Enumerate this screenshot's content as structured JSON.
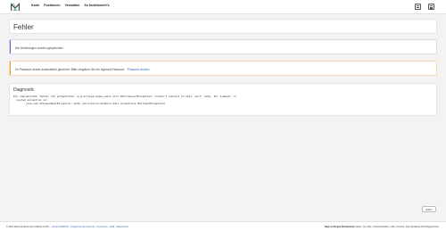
{
  "nav": {
    "items": [
      {
        "label": "Karte"
      },
      {
        "label": "Positionen"
      },
      {
        "label": "Verwalten"
      },
      {
        "label": "So funktioniert's"
      }
    ]
  },
  "page": {
    "title": "Fehler"
  },
  "alerts": {
    "success_text": "Die Änderungen wurden gespeichert.",
    "warning_text": "Ihr Passwort wurde automatisch generiert. Bitte vergeben Sie ein eigenes Passwort.",
    "warning_link": "Passwort ändern"
  },
  "diagnostic": {
    "heading": "Diagnostic",
    "lines": [
      "Ein unerwarteter Fehler ist aufgetreten: org.eclipse.angus.mail.util.MailConnectException: Couldn't connect to host, port: smtp, 25; timeout -1;",
      "  nested exception is:",
      "\tjava.net.UnknownHostException: smtp (de.minerva-medtech.mail.exceptions.MailSentException)"
    ]
  },
  "help": {
    "label": "Hilfe?"
  },
  "footer": {
    "copyright": "© 2024 Minerval Medic Deutschland GmbH · ",
    "links": [
      "+49 30 23585720",
      "info@minerval-medic.de",
      "Impressum",
      "AGB",
      "Datenschutz"
    ],
    "separator": " · ",
    "right_label": "Save-to-Project Permissions",
    "right_text": " (Save: Yes v42) | 2 Frame/Station | URL of Frame: http://localhost:2077/trigger/home"
  },
  "colors": {
    "success_bar": "#5e64b8",
    "warning_bar": "#e6a521",
    "link": "#2f6fc8"
  },
  "icons": {
    "logo": "minerval-logo",
    "tray": [
      "grid-icon",
      "menu-icon"
    ]
  }
}
